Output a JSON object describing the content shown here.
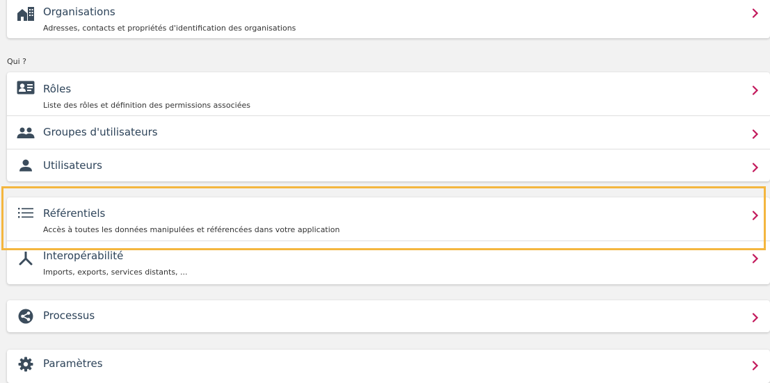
{
  "colors": {
    "chevron": "#c2185b",
    "icon": "#3b4c5c",
    "highlight": "#f4b63f",
    "background": "#f2f2f2"
  },
  "organisations": {
    "title": "Organisations",
    "description": "Adresses, contacts et propriétés d'identification des organisations",
    "icon": "building-icon"
  },
  "who_section": {
    "label": "Qui ?",
    "items": [
      {
        "title": "Rôles",
        "description": "Liste des rôles et définition des permissions associées",
        "icon": "id-card-icon"
      },
      {
        "title": "Groupes d'utilisateurs",
        "description": "",
        "icon": "users-icon"
      },
      {
        "title": "Utilisateurs",
        "description": "",
        "icon": "user-icon"
      }
    ]
  },
  "data_section": {
    "items": [
      {
        "title": "Référentiels",
        "description": "Accès à toutes les données manipulées et référencées dans votre application",
        "icon": "list-icon"
      },
      {
        "title": "Interopérabilité",
        "description": "Imports, exports, services distants, ...",
        "icon": "network-icon"
      }
    ]
  },
  "processus": {
    "title": "Processus",
    "icon": "share-circle-icon"
  },
  "parametres": {
    "title": "Paramètres",
    "icon": "gear-icon"
  }
}
